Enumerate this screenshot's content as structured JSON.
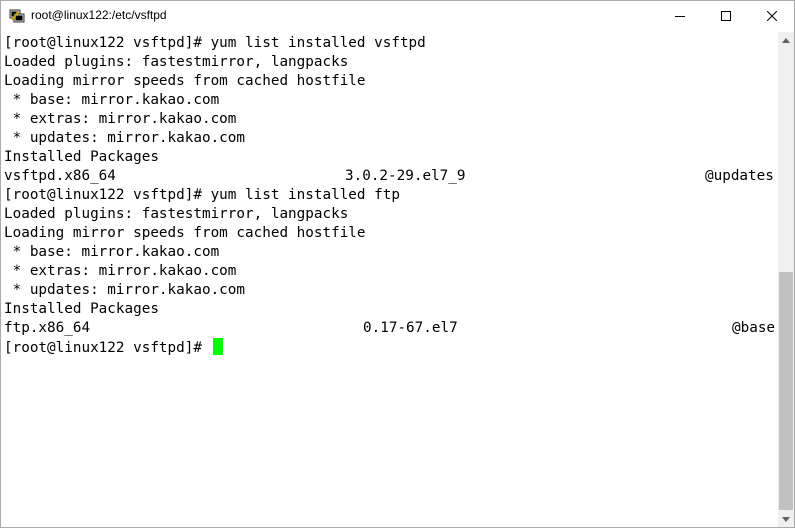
{
  "window": {
    "title": "root@linux122:/etc/vsftpd",
    "icon": "putty-terminal-icon",
    "controls": {
      "minimize": "minimize-icon",
      "maximize": "maximize-icon",
      "close": "close-icon"
    }
  },
  "terminal": {
    "cursor_color": "#00ff00",
    "text_color": "#000000",
    "background": "#ffffff",
    "lines": [
      "[root@linux122 vsftpd]# yum list installed vsftpd",
      "Loaded plugins: fastestmirror, langpacks",
      "Loading mirror speeds from cached hostfile",
      " * base: mirror.kakao.com",
      " * extras: mirror.kakao.com",
      " * updates: mirror.kakao.com",
      "Installed Packages",
      "",
      "[root@linux122 vsftpd]# yum list installed ftp",
      "Loaded plugins: fastestmirror, langpacks",
      "Loading mirror speeds from cached hostfile",
      " * base: mirror.kakao.com",
      " * extras: mirror.kakao.com",
      " * updates: mirror.kakao.com",
      "Installed Packages",
      "",
      "[root@linux122 vsftpd]# "
    ],
    "packages": [
      {
        "name": "vsftpd.x86_64",
        "version": "3.0.2-29.el7_9",
        "repo": "@updates"
      },
      {
        "name": "ftp.x86_64",
        "version": "0.17-67.el7",
        "repo": "@base"
      }
    ]
  },
  "scrollbar": {
    "up_icon": "scroll-up-arrow-icon",
    "down_icon": "scroll-down-arrow-icon"
  }
}
